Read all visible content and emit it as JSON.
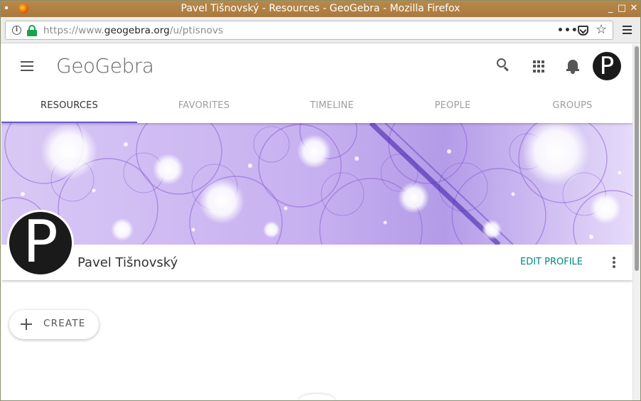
{
  "window": {
    "title": "Pavel Tišnovský - Resources - GeoGebra - Mozilla Firefox",
    "controls": {
      "minimize": "_",
      "maximize": "□",
      "close": "✕"
    }
  },
  "browser": {
    "url_prefix": "https://www.",
    "url_domain": "geogebra.org",
    "url_path": "/u/ptisnovs",
    "more_label": "•••",
    "star_label": "☆"
  },
  "app": {
    "logo": "GeoGebra",
    "avatar_initial": "P"
  },
  "tabs": [
    {
      "label": "RESOURCES",
      "active": true
    },
    {
      "label": "FAVORITES",
      "active": false
    },
    {
      "label": "TIMELINE",
      "active": false
    },
    {
      "label": "PEOPLE",
      "active": false
    },
    {
      "label": "GROUPS",
      "active": false
    }
  ],
  "profile": {
    "name": "Pavel Tišnovský",
    "avatar_initial": "P",
    "edit_label": "EDIT PROFILE"
  },
  "actions": {
    "create_label": "CREATE"
  },
  "colors": {
    "accent": "#6557d2",
    "edit_link": "#00897b",
    "banner_purple": "#6a3fd0"
  }
}
